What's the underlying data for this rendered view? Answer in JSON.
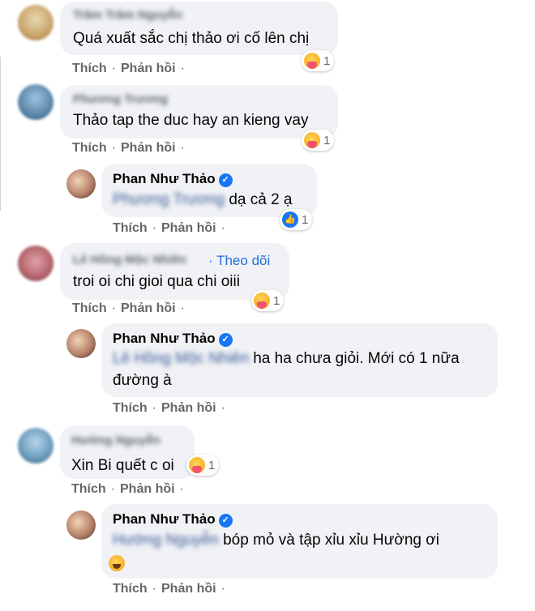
{
  "actions": {
    "like": "Thích",
    "reply": "Phản hồi",
    "sep": "·"
  },
  "comments": [
    {
      "author": "Trâm Trâm Nguyễn",
      "text": "Quá xuất sắc chị thảo ơi cố lên chị",
      "reaction": {
        "type": "care",
        "count": "1"
      }
    },
    {
      "author": "Phương Trương",
      "text": "Thảo tap the duc hay an kieng vay",
      "reaction": {
        "type": "care",
        "count": "1"
      }
    },
    {
      "author": "Phan Như Thảo",
      "verified": true,
      "mention": "Phương Trương",
      "text": "dạ cả 2 ạ",
      "reaction": {
        "type": "like",
        "count": "1"
      }
    },
    {
      "author": "Lê Hồng Mộc Nhiên",
      "follow": "Theo dõi",
      "text": "troi oi chi gioi qua chi oiii",
      "reaction": {
        "type": "care",
        "count": "1"
      }
    },
    {
      "author": "Phan Như Thảo",
      "verified": true,
      "mention": "Lê Hồng Mộc Nhiên",
      "text_line1": "ha ha chưa giỏi. Mới có 1 nữa",
      "text_line2": "đường à"
    },
    {
      "author": "Hường Nguyễn",
      "text": "Xin Bi quết c oi",
      "reaction": {
        "type": "care",
        "count": "1"
      }
    },
    {
      "author": "Phan Như Thảo",
      "verified": true,
      "mention": "Hường Nguyễn",
      "text": "bóp mỏ và tập xỉu xỉu Hường ơi",
      "emoji": "laughing-emoji"
    }
  ],
  "colors": {
    "bubble": "#f0f2f5",
    "link": "#216fdb",
    "verified": "#1877f2",
    "meta": "#65676b"
  }
}
